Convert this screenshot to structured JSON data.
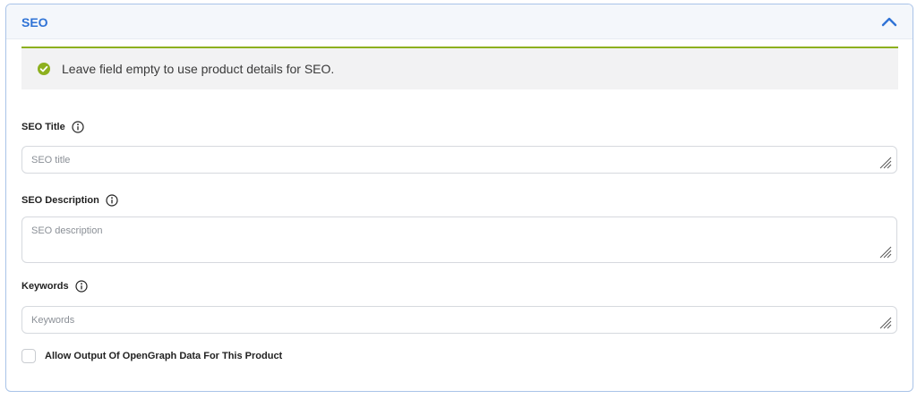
{
  "panel": {
    "title": "SEO",
    "collapse_icon": "chevron-up-icon",
    "accent_color": "#2f73d6"
  },
  "notice": {
    "icon": "check-circle-icon",
    "text": "Leave field empty to use product details for SEO.",
    "accent_color": "#8db01e"
  },
  "fields": {
    "seo_title": {
      "label": "SEO Title",
      "placeholder": "SEO title",
      "value": ""
    },
    "seo_description": {
      "label": "SEO Description",
      "placeholder": "SEO description",
      "value": ""
    },
    "keywords": {
      "label": "Keywords",
      "placeholder": "Keywords",
      "value": ""
    }
  },
  "opengraph": {
    "label": "Allow Output Of OpenGraph Data For This Product",
    "checked": false
  }
}
